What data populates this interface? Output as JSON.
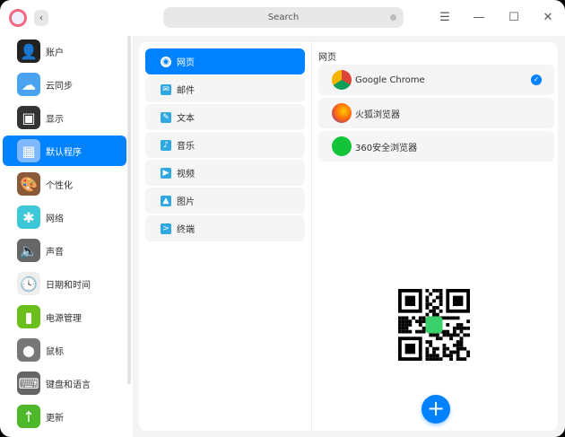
{
  "titlebar": {
    "search_placeholder": "Search",
    "back": "‹",
    "menu": "☰",
    "minimize": "—",
    "maximize": "☐",
    "close": "✕"
  },
  "sidebar": {
    "items": [
      {
        "label": "账户",
        "icon": "account-icon"
      },
      {
        "label": "云同步",
        "icon": "cloud-sync-icon"
      },
      {
        "label": "显示",
        "icon": "display-icon"
      },
      {
        "label": "默认程序",
        "icon": "default-apps-icon",
        "selected": true
      },
      {
        "label": "个性化",
        "icon": "personalization-icon"
      },
      {
        "label": "网络",
        "icon": "network-icon"
      },
      {
        "label": "声音",
        "icon": "sound-icon"
      },
      {
        "label": "日期和时间",
        "icon": "clock-icon"
      },
      {
        "label": "电源管理",
        "icon": "battery-icon"
      },
      {
        "label": "鼠标",
        "icon": "mouse-icon"
      },
      {
        "label": "键盘和语言",
        "icon": "keyboard-icon"
      },
      {
        "label": "更新",
        "icon": "update-icon"
      }
    ]
  },
  "categories": [
    {
      "label": "网页",
      "icon": "globe-icon",
      "selected": true
    },
    {
      "label": "邮件",
      "icon": "mail-icon"
    },
    {
      "label": "文本",
      "icon": "pencil-icon"
    },
    {
      "label": "音乐",
      "icon": "music-icon"
    },
    {
      "label": "视频",
      "icon": "video-icon"
    },
    {
      "label": "图片",
      "icon": "image-icon"
    },
    {
      "label": "终端",
      "icon": "terminal-icon"
    }
  ],
  "apps": {
    "title": "网页",
    "items": [
      {
        "label": "Google Chrome",
        "default": true
      },
      {
        "label": "火狐浏览器"
      },
      {
        "label": "360安全浏览器"
      }
    ]
  },
  "add_button": "+",
  "accent": "#0081ff"
}
